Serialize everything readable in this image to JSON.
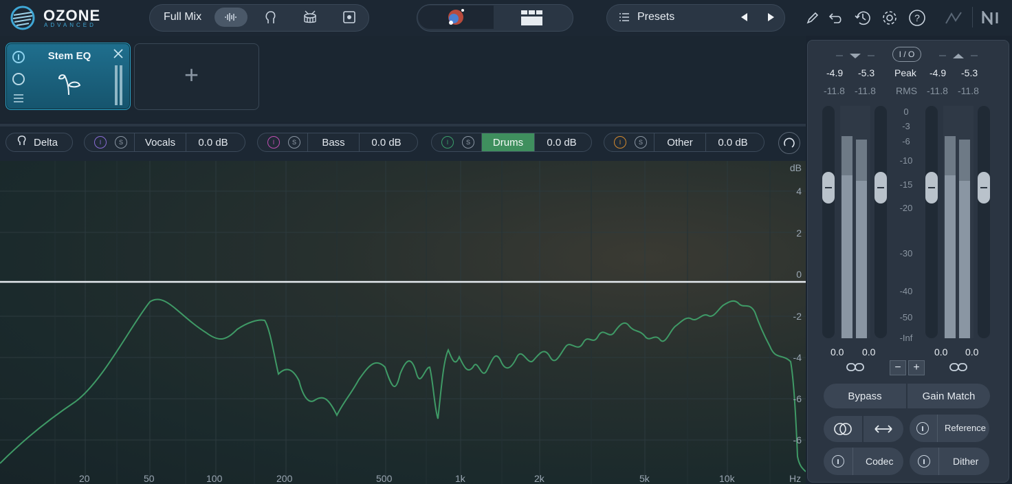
{
  "app": {
    "name": "OZONE",
    "edition": "ADVANCED"
  },
  "top": {
    "mix_label": "Full Mix",
    "presets_label": "Presets",
    "icons": [
      "waveform-icon",
      "vocals-head-icon",
      "drum-icon",
      "module-icon",
      "spectrum-orb-icon",
      "grid-view-icon",
      "list-icon",
      "prev-arrow-icon",
      "next-arrow-icon",
      "pencil-icon",
      "undo-icon",
      "history-icon",
      "gear-icon",
      "help-icon",
      "ni-logo-icon"
    ]
  },
  "module": {
    "name": "Stem EQ",
    "add_symbol": "+"
  },
  "controls": {
    "delta": "Delta",
    "stems": [
      {
        "name": "Vocals",
        "gain": "0.0 dB",
        "color": "#8a6cd6",
        "active": false
      },
      {
        "name": "Bass",
        "gain": "0.0 dB",
        "color": "#c04fb3",
        "active": false
      },
      {
        "name": "Drums",
        "gain": "0.0 dB",
        "color": "#3aa06a",
        "active": true
      },
      {
        "name": "Other",
        "gain": "0.0 dB",
        "color": "#d58a2e",
        "active": false
      }
    ]
  },
  "eq": {
    "db_unit": "dB",
    "db_ticks": [
      "4",
      "2",
      "0",
      "-2",
      "-4",
      "-6",
      "-6"
    ],
    "hz_ticks": [
      "20",
      "50",
      "100",
      "200",
      "500",
      "1k",
      "2k",
      "5k",
      "10k",
      "Hz"
    ],
    "curve_color": "#3f9a66"
  },
  "meter": {
    "io_label": "I / O",
    "peak_label": "Peak",
    "rms_label": "RMS",
    "in_peak_l": "-4.9",
    "in_peak_r": "-5.3",
    "out_peak_l": "-4.9",
    "out_peak_r": "-5.3",
    "in_rms_l": "-11.8",
    "in_rms_r": "-11.8",
    "out_rms_l": "-11.8",
    "out_rms_r": "-11.8",
    "scale": [
      "0",
      "-3",
      "-6",
      "-10",
      "-15",
      "-20",
      "-30",
      "-40",
      "-50",
      "-Inf"
    ],
    "in_gain_l": "0.0",
    "in_gain_r": "0.0",
    "out_gain_l": "0.0",
    "out_gain_r": "0.0",
    "minus": "−",
    "plus": "+",
    "bypass": "Bypass",
    "gain_match": "Gain Match",
    "reference": "Reference",
    "codec": "Codec",
    "dither": "Dither"
  }
}
